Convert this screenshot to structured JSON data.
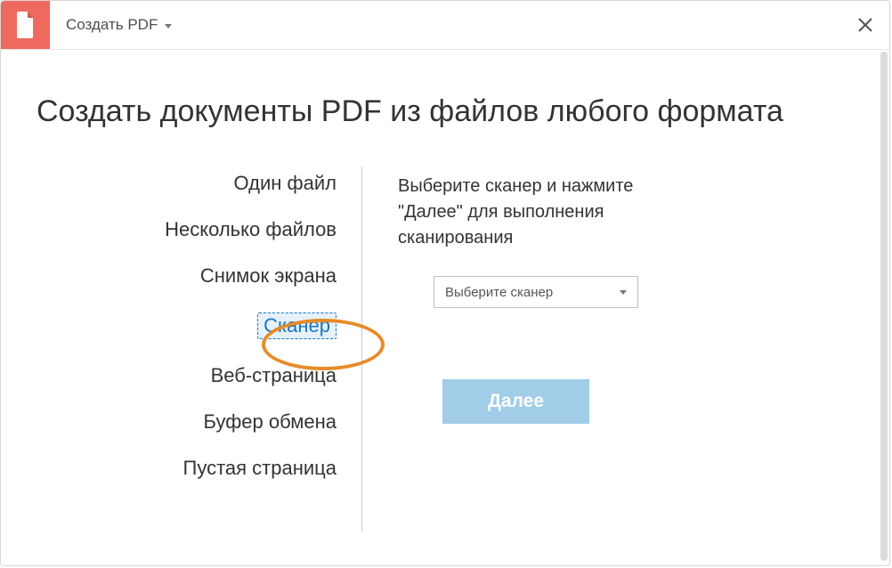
{
  "header": {
    "dropdown_label": "Создать PDF"
  },
  "page_title": "Создать документы PDF из файлов любого формата",
  "left_items": [
    "Один файл",
    "Несколько файлов",
    "Снимок экрана",
    "Сканер",
    "Веб-страница",
    "Буфер обмена",
    "Пустая страница"
  ],
  "selected_index": 3,
  "right": {
    "instructions": "Выберите сканер и нажмите \"Далее\" для выполнения сканирования",
    "select_placeholder": "Выберите сканер",
    "next_label": "Далее"
  }
}
